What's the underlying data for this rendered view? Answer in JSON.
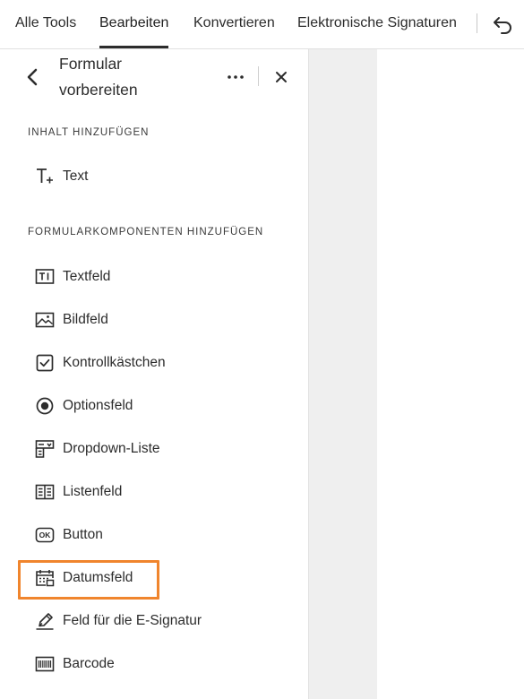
{
  "topbar": {
    "tabs": [
      "Alle Tools",
      "Bearbeiten",
      "Konvertieren",
      "Elektronische Signaturen"
    ],
    "active_tab": "Bearbeiten",
    "undo_icon": "undo-icon"
  },
  "panel": {
    "title": "Formular vorbereiten",
    "back_icon": "chevron-left-icon",
    "more_icon": "more-icon",
    "close_icon": "close-icon",
    "sections": [
      {
        "label": "INHALT HINZUFÜGEN"
      },
      {
        "label": "FORMULARKOMPONENTEN HINZUFÜGEN"
      }
    ],
    "content_items": [
      {
        "label": "Text",
        "icon": "text-add-icon"
      }
    ],
    "form_items": [
      {
        "label": "Textfeld",
        "icon": "text-field-icon"
      },
      {
        "label": "Bildfeld",
        "icon": "image-field-icon"
      },
      {
        "label": "Kontrollkästchen",
        "icon": "checkbox-icon"
      },
      {
        "label": "Optionsfeld",
        "icon": "radio-button-icon"
      },
      {
        "label": "Dropdown-Liste",
        "icon": "dropdown-list-icon"
      },
      {
        "label": "Listenfeld",
        "icon": "list-box-icon"
      },
      {
        "label": "Button",
        "icon": "ok-button-icon"
      },
      {
        "label": "Datumsfeld",
        "icon": "calendar-icon"
      },
      {
        "label": "Feld für die E-Signatur",
        "icon": "signature-pen-icon"
      },
      {
        "label": "Barcode",
        "icon": "barcode-icon"
      }
    ],
    "highlighted_item": "Datumsfeld",
    "highlight_color": "#f0852d"
  }
}
